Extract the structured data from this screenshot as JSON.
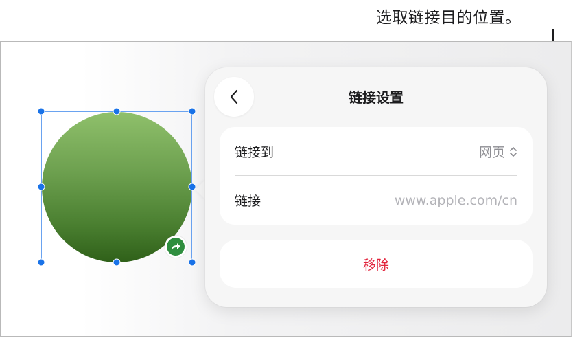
{
  "callout": {
    "text": "选取链接目的位置。"
  },
  "popover": {
    "title": "链接设置",
    "back_icon": "chevron-left-icon",
    "link_to": {
      "label": "链接到",
      "value": "网页",
      "icon": "chevron-up-down-icon"
    },
    "link": {
      "label": "链接",
      "placeholder": "www.apple.com/cn"
    },
    "remove_label": "移除"
  },
  "shape": {
    "type": "circle",
    "badge_icon": "link-arrow-icon"
  },
  "colors": {
    "accent_blue": "#1a73e8",
    "destructive_red": "#e2243c",
    "shape_green_top": "#8fc06b",
    "shape_green_bottom": "#2f6019",
    "badge_green": "#2f8e3f"
  }
}
